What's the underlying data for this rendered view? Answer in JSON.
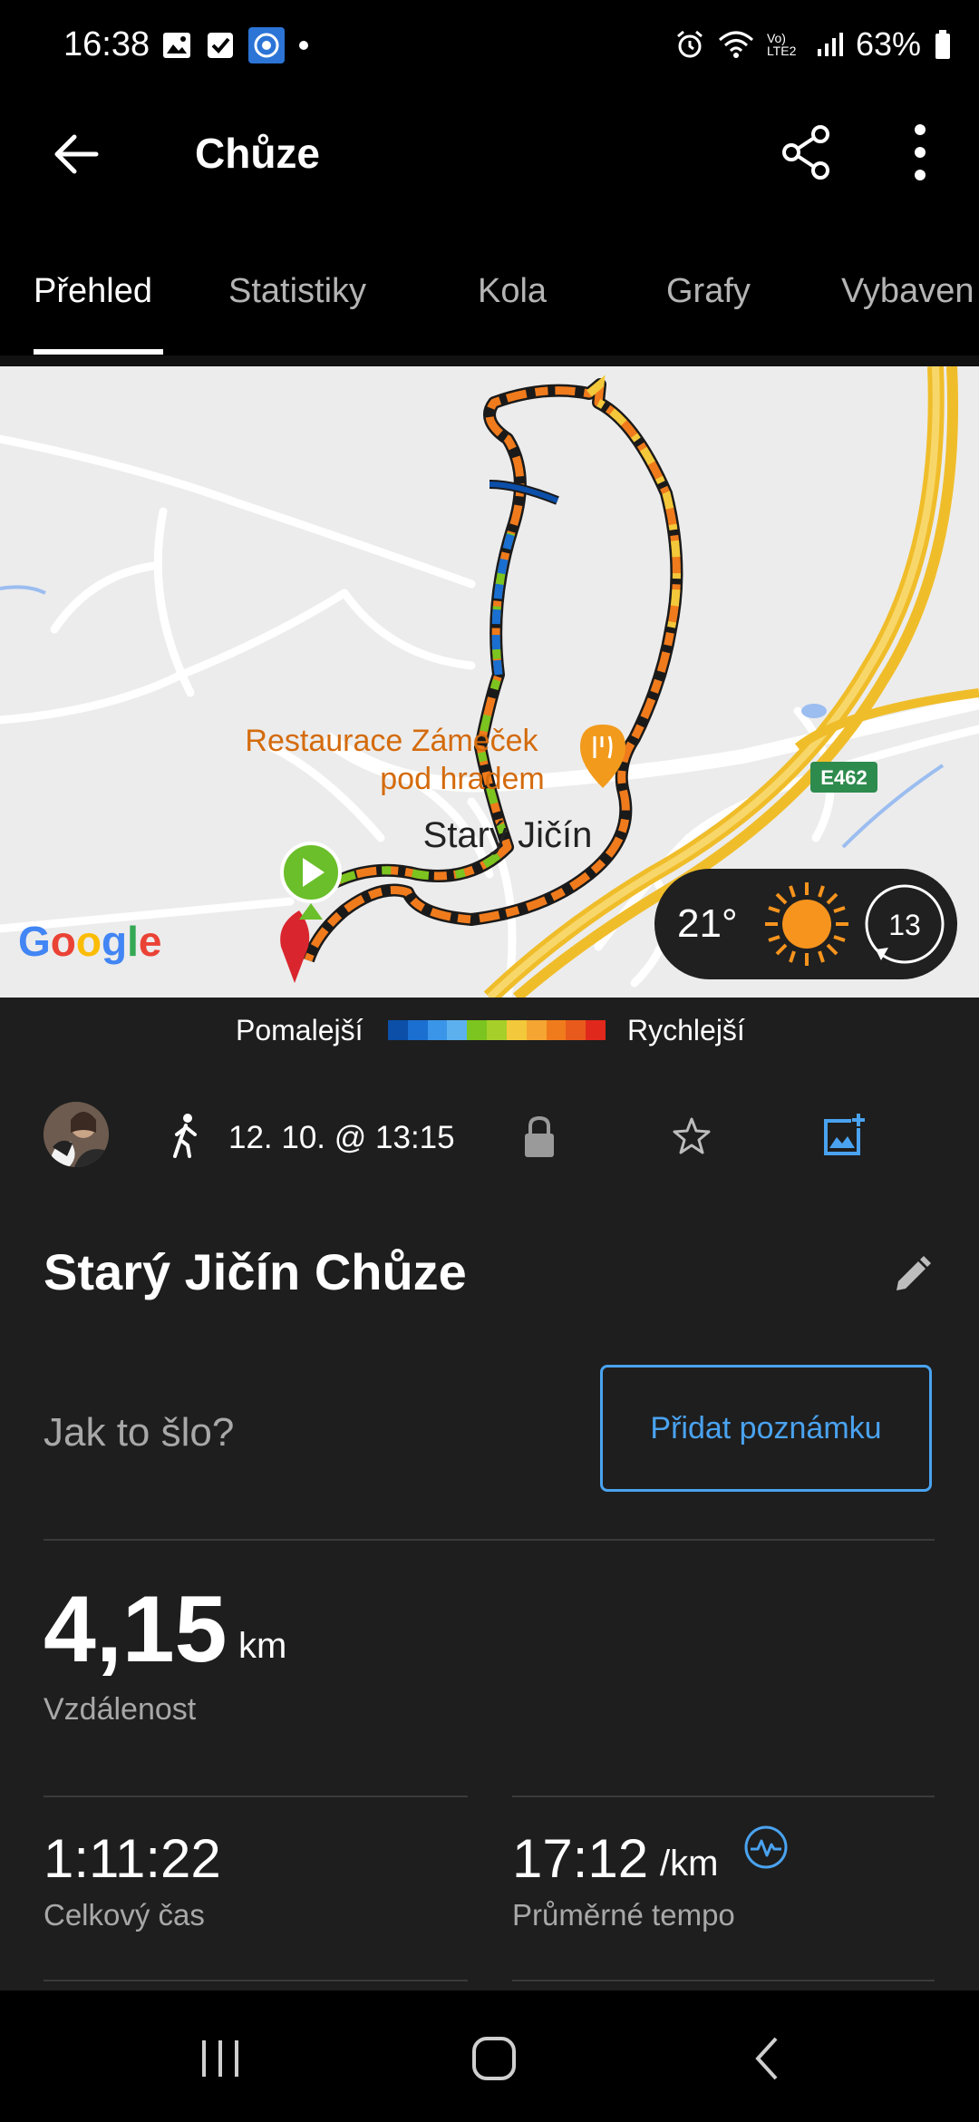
{
  "status_bar": {
    "time": "16:38",
    "battery": "63%",
    "network": "Vo) LTE2"
  },
  "app_bar": {
    "title": "Chůze"
  },
  "tabs": [
    {
      "label": "Přehled",
      "active": true
    },
    {
      "label": "Statistiky",
      "active": false
    },
    {
      "label": "Kola",
      "active": false
    },
    {
      "label": "Grafy",
      "active": false
    },
    {
      "label": "Vybaven",
      "active": false
    }
  ],
  "map": {
    "place_label": "Starý Jičín",
    "poi_label_line1": "Restaurace Zámeček",
    "poi_label_line2": "pod hradem",
    "road_label": "E462",
    "provider": "Google",
    "weather": {
      "temperature": "21°",
      "icon": "sun-icon",
      "wind_speed": "13"
    }
  },
  "legend": {
    "slower": "Pomalejší",
    "faster": "Rychlejší",
    "colors": [
      "#0b4fa8",
      "#1a6fd0",
      "#3a95e8",
      "#5cb0ee",
      "#7cc41f",
      "#a6cf2a",
      "#f3c83a",
      "#f5a531",
      "#f07b1c",
      "#e85a1c",
      "#e0281c"
    ]
  },
  "activity": {
    "avatar": "avatar",
    "type_icon": "walk-icon",
    "datetime": "12. 10. @ 13:15",
    "title": "Starý Jičín Chůze",
    "note_prompt": "Jak to šlo?",
    "note_button": "Přidat poznámku"
  },
  "stats": {
    "distance": {
      "value": "4,15",
      "unit": "km",
      "label": "Vzdálenost"
    },
    "total_time": {
      "value": "1:11:22",
      "label": "Celkový čas"
    },
    "avg_pace": {
      "value": "17:12",
      "unit": "/km",
      "label": "Průměrné tempo"
    }
  },
  "colors": {
    "accent": "#4aa3f0",
    "background": "#1e1e1e",
    "route_start": "#6bbf2a",
    "route_end": "#d9262e"
  }
}
